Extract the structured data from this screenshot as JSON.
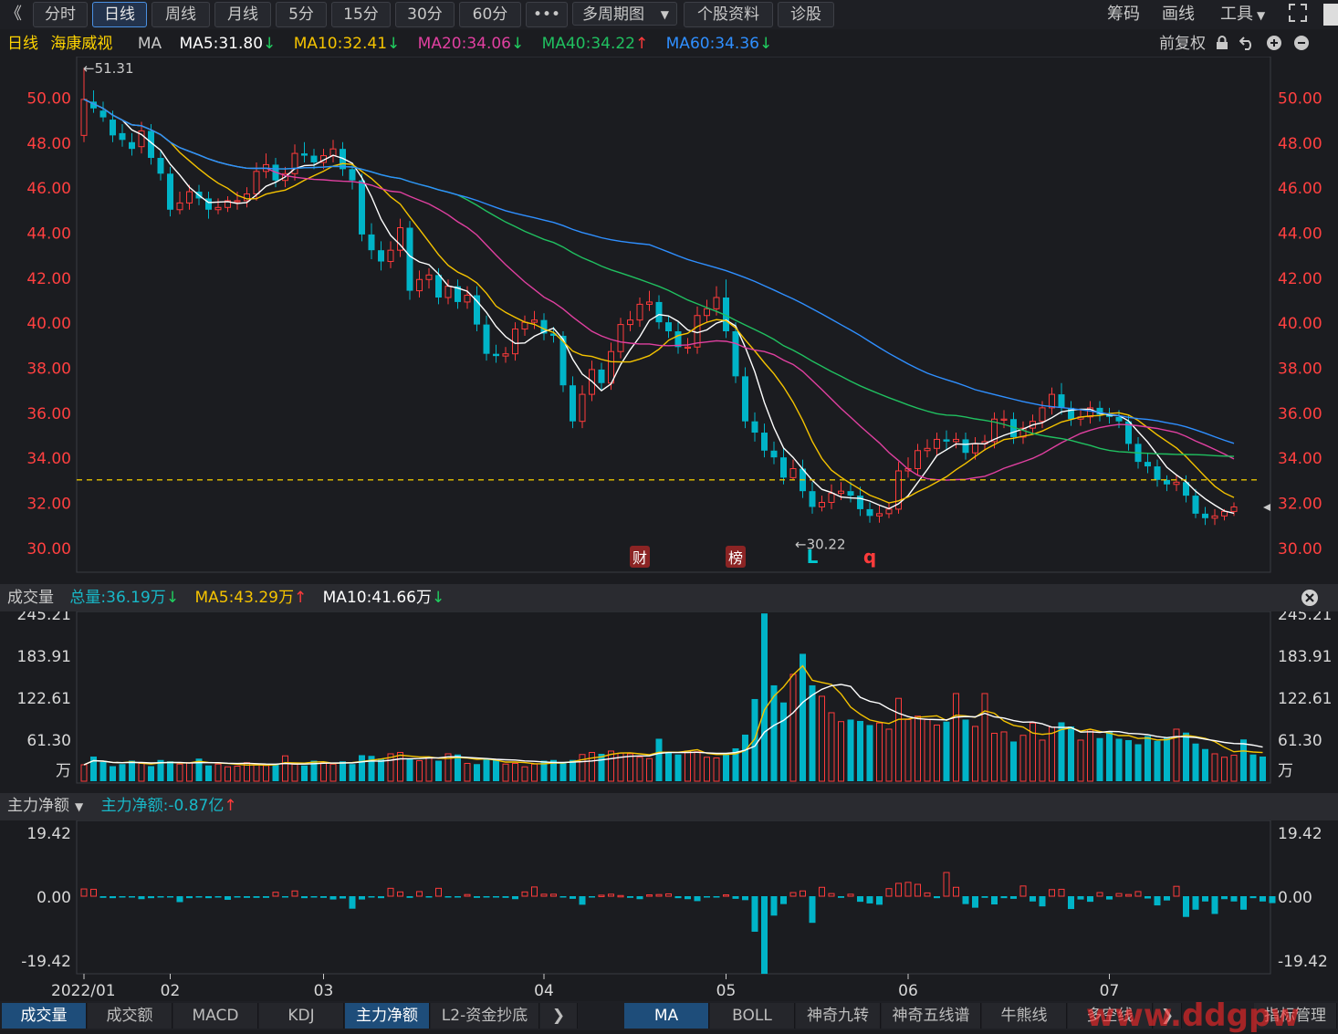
{
  "toolbar": {
    "back_label": "《",
    "periods": [
      "分时",
      "日线",
      "周线",
      "月线",
      "5分",
      "15分",
      "30分",
      "60分"
    ],
    "active_period": "日线",
    "more_label": "•••",
    "multi_period_label": "多周期图",
    "stock_info_label": "个股资料",
    "diagnose_label": "诊股",
    "chips_label": "筹码",
    "draw_label": "画线",
    "tools_label": "工具",
    "fullscreen_icon": "expand-icon"
  },
  "main_legend": {
    "period": "日线",
    "stock_name": "海康威视",
    "indicator": "MA",
    "ma5": "MA5:31.80",
    "ma10": "MA10:32.41",
    "ma20": "MA20:34.06",
    "ma40": "MA40:34.22",
    "ma60": "MA60:34.36",
    "adjust_label": "前复权"
  },
  "volume_legend": {
    "title": "成交量",
    "total": "总量:36.19万",
    "ma5": "MA5:43.29万",
    "ma10": "MA10:41.66万"
  },
  "flow_legend": {
    "title": "主力净额",
    "value": "主力净额:-0.87亿"
  },
  "colors": {
    "up": "#ff3b3b",
    "down": "#00b4c8",
    "ma5": "#ffffff",
    "ma10": "#f5c300",
    "ma20": "#e040a0",
    "ma40": "#20c060",
    "ma60": "#2f8fff",
    "price_axis": "#ff4040",
    "dashed": "#e6c200"
  },
  "chart_data": [
    {
      "type": "candlestick",
      "title": "海康威视 日线",
      "y_ticks": [
        "50.00",
        "48.00",
        "46.00",
        "44.00",
        "42.00",
        "40.00",
        "38.00",
        "36.00",
        "34.00",
        "32.00",
        "30.00"
      ],
      "ylim": [
        29.0,
        51.5
      ],
      "high_marker": "←51.31",
      "low_marker": "←30.22",
      "reference_line": 33.0,
      "event_markers": [
        {
          "label": "财",
          "x_index": 58
        },
        {
          "label": "榜",
          "x_index": 68
        }
      ],
      "signal_markers": [
        {
          "label": "L",
          "x_index": 76,
          "color": "#00c8d0"
        },
        {
          "label": "q",
          "x_index": 82,
          "color": "#ff3b3b"
        }
      ],
      "x_ticks": [
        {
          "label": "2022/01",
          "index": 0
        },
        {
          "label": "02",
          "index": 9
        },
        {
          "label": "03",
          "index": 25
        },
        {
          "label": "04",
          "index": 48
        },
        {
          "label": "05",
          "index": 67
        },
        {
          "label": "06",
          "index": 86
        },
        {
          "label": "07",
          "index": 107
        }
      ],
      "candles": {
        "open": [
          48.3,
          49.8,
          49.4,
          49.0,
          48.4,
          48.0,
          47.8,
          48.5,
          47.3,
          46.6,
          45.0,
          45.3,
          45.8,
          45.5,
          45.0,
          45.1,
          45.4,
          45.4,
          45.7,
          46.7,
          47.0,
          46.3,
          46.6,
          47.5,
          47.4,
          47.1,
          47.4,
          47.7,
          46.8,
          46.3,
          43.9,
          43.2,
          42.7,
          43.2,
          44.2,
          41.4,
          41.9,
          42.1,
          41.1,
          41.6,
          40.9,
          41.2,
          39.9,
          38.6,
          38.5,
          38.6,
          39.7,
          40.0,
          40.1,
          39.5,
          39.4,
          37.2,
          35.6,
          36.8,
          37.9,
          37.3,
          38.7,
          39.9,
          40.1,
          40.8,
          40.9,
          40.0,
          39.6,
          38.9,
          38.9,
          40.3,
          40.6,
          41.1,
          39.6,
          37.6,
          35.6,
          35.1,
          34.3,
          34.0,
          33.1,
          33.5,
          32.5,
          31.8,
          32.0,
          32.4,
          32.5,
          32.3,
          31.7,
          31.4,
          31.5,
          31.7,
          33.4,
          33.5,
          34.3,
          34.4,
          34.8,
          34.7,
          34.8,
          34.2,
          34.6,
          34.7,
          35.7,
          35.7,
          34.9,
          35.3,
          35.6,
          36.2,
          36.8,
          36.2,
          35.7,
          35.8,
          36.2,
          35.9,
          35.8,
          35.6,
          34.6,
          33.8,
          33.6,
          33.0,
          32.8,
          32.9,
          32.3,
          31.5,
          31.3,
          31.4,
          31.6
        ],
        "close": [
          49.9,
          49.5,
          49.1,
          48.3,
          48.1,
          47.7,
          48.5,
          47.3,
          46.6,
          45.0,
          45.3,
          45.8,
          45.5,
          45.0,
          45.1,
          45.4,
          45.4,
          45.7,
          46.7,
          47.0,
          46.3,
          46.6,
          47.5,
          47.4,
          47.1,
          47.4,
          47.7,
          46.8,
          46.3,
          43.9,
          43.2,
          42.7,
          43.2,
          44.2,
          41.4,
          41.9,
          42.1,
          41.1,
          41.6,
          40.9,
          41.2,
          39.9,
          38.6,
          38.5,
          38.6,
          39.7,
          40.0,
          40.1,
          39.5,
          39.4,
          37.2,
          35.6,
          36.8,
          37.9,
          37.3,
          38.7,
          39.9,
          40.1,
          40.8,
          40.9,
          40.0,
          39.6,
          38.9,
          38.9,
          40.3,
          40.6,
          41.1,
          39.6,
          37.6,
          35.6,
          35.1,
          34.3,
          34.0,
          33.1,
          33.5,
          32.5,
          31.8,
          32.0,
          32.4,
          32.5,
          32.3,
          31.7,
          31.4,
          31.5,
          31.7,
          33.4,
          33.5,
          34.3,
          34.4,
          34.8,
          34.7,
          34.8,
          34.2,
          34.6,
          34.7,
          35.7,
          35.7,
          34.9,
          35.3,
          35.6,
          36.2,
          36.8,
          36.2,
          35.7,
          35.8,
          36.2,
          35.9,
          35.8,
          35.6,
          34.6,
          33.8,
          33.6,
          33.0,
          32.8,
          32.9,
          32.3,
          31.5,
          31.3,
          31.4,
          31.6,
          31.8
        ],
        "high": [
          51.3,
          50.3,
          49.8,
          49.4,
          48.8,
          48.4,
          48.9,
          48.8,
          47.6,
          46.9,
          45.8,
          46.1,
          46.1,
          45.8,
          45.5,
          45.6,
          45.8,
          46.0,
          47.1,
          47.5,
          47.3,
          46.9,
          47.9,
          48.0,
          47.7,
          47.7,
          48.1,
          48.0,
          47.1,
          46.6,
          44.4,
          43.6,
          43.6,
          44.6,
          44.5,
          42.3,
          42.4,
          42.4,
          41.9,
          41.9,
          41.6,
          41.6,
          40.3,
          39.0,
          38.9,
          40.0,
          40.3,
          40.5,
          40.4,
          39.8,
          39.6,
          37.6,
          37.2,
          38.3,
          38.2,
          39.1,
          40.2,
          40.5,
          41.1,
          41.4,
          41.2,
          40.3,
          40.0,
          39.3,
          40.7,
          41.0,
          41.6,
          41.9,
          40.0,
          38.0,
          36.0,
          35.5,
          34.7,
          34.4,
          33.9,
          33.9,
          32.9,
          32.3,
          32.8,
          32.9,
          32.9,
          32.7,
          32.0,
          31.9,
          32.0,
          33.8,
          34.0,
          34.6,
          34.8,
          35.1,
          35.2,
          35.1,
          35.1,
          34.9,
          35.0,
          36.0,
          36.1,
          36.0,
          35.6,
          35.9,
          36.5,
          37.1,
          37.3,
          36.5,
          36.1,
          36.5,
          36.5,
          36.2,
          36.1,
          35.9,
          34.9,
          34.2,
          33.9,
          33.2,
          33.2,
          33.2,
          32.6,
          31.8,
          31.7,
          31.7,
          32.0
        ],
        "low": [
          48.0,
          49.3,
          48.9,
          48.0,
          47.8,
          47.4,
          47.5,
          47.0,
          46.3,
          44.7,
          44.8,
          45.0,
          45.2,
          44.6,
          44.8,
          44.9,
          45.0,
          45.1,
          45.4,
          46.4,
          46.0,
          46.0,
          46.3,
          47.1,
          46.8,
          46.8,
          47.1,
          46.5,
          45.9,
          43.6,
          42.8,
          42.3,
          42.4,
          42.9,
          41.0,
          41.1,
          41.5,
          40.8,
          40.8,
          40.6,
          40.6,
          39.6,
          38.3,
          38.2,
          38.2,
          38.3,
          39.4,
          39.7,
          39.2,
          39.1,
          36.9,
          35.3,
          35.3,
          36.5,
          37.0,
          37.0,
          38.4,
          39.6,
          39.8,
          40.5,
          39.7,
          39.3,
          38.6,
          38.6,
          38.6,
          40.0,
          40.3,
          39.3,
          37.3,
          35.3,
          34.7,
          34.0,
          33.7,
          32.8,
          33.0,
          32.2,
          31.5,
          31.6,
          31.7,
          32.1,
          32.0,
          31.4,
          31.1,
          31.1,
          31.3,
          31.5,
          33.1,
          33.2,
          34.0,
          34.1,
          34.3,
          34.4,
          33.9,
          33.9,
          34.3,
          34.4,
          35.3,
          34.6,
          34.6,
          35.0,
          35.3,
          35.9,
          35.9,
          35.4,
          35.4,
          35.5,
          35.6,
          35.5,
          35.3,
          34.3,
          33.5,
          33.3,
          32.7,
          32.5,
          32.5,
          32.0,
          31.3,
          31.0,
          31.0,
          31.2,
          31.4
        ]
      },
      "ma_series": [
        {
          "name": "MA5",
          "color": "#ffffff",
          "end": 31.8
        },
        {
          "name": "MA10",
          "color": "#f5c300",
          "end": 32.41
        },
        {
          "name": "MA20",
          "color": "#e040a0",
          "end": 34.06
        },
        {
          "name": "MA40",
          "color": "#20c060",
          "end": 34.22
        },
        {
          "name": "MA60",
          "color": "#2f8fff",
          "end": 34.36
        }
      ]
    },
    {
      "type": "bar",
      "title": "成交量",
      "unit": "万",
      "y_ticks": [
        "245.21",
        "183.91",
        "122.61",
        "61.30"
      ],
      "ylim": [
        0,
        245.21
      ],
      "values": [
        24,
        36,
        28,
        22,
        25,
        30,
        26,
        22,
        31,
        29,
        25,
        27,
        33,
        23,
        25,
        21,
        22,
        27,
        24,
        23,
        24,
        37,
        25,
        23,
        30,
        27,
        25,
        29,
        25,
        38,
        37,
        33,
        40,
        42,
        32,
        30,
        34,
        30,
        40,
        39,
        26,
        25,
        33,
        31,
        25,
        26,
        21,
        25,
        30,
        31,
        26,
        31,
        39,
        42,
        40,
        44,
        41,
        40,
        35,
        33,
        62,
        42,
        39,
        44,
        43,
        35,
        34,
        39,
        48,
        68,
        120,
        245,
        140,
        115,
        156,
        186,
        140,
        124,
        100,
        87,
        90,
        88,
        82,
        85,
        76,
        121,
        90,
        95,
        90,
        82,
        87,
        128,
        90,
        80,
        128,
        70,
        72,
        58,
        67,
        85,
        60,
        79,
        86,
        80,
        60,
        75,
        63,
        73,
        62,
        60,
        54,
        66,
        59,
        64,
        76,
        71,
        55,
        47,
        40,
        35,
        38,
        61,
        39,
        36
      ],
      "ma_series": [
        {
          "name": "MA5",
          "color": "#f5c300",
          "end": 43.29
        },
        {
          "name": "MA10",
          "color": "#ffffff",
          "end": 41.66
        }
      ],
      "last_total": 36.19
    },
    {
      "type": "bar",
      "title": "主力净额",
      "unit": "亿",
      "y_ticks": [
        "19.42",
        "0.00",
        "-19.42"
      ],
      "ylim": [
        -19.42,
        19.42
      ],
      "values": [
        2.2,
        2.1,
        -0.5,
        -0.6,
        -0.4,
        -0.3,
        -0.9,
        -0.6,
        -0.4,
        -0.4,
        -1.8,
        -0.6,
        -0.3,
        -0.6,
        -0.4,
        -1.1,
        -0.3,
        -0.5,
        -0.5,
        -0.5,
        1.2,
        -0.2,
        1.6,
        -0.6,
        -0.4,
        -0.5,
        -1.0,
        -0.7,
        -3.8,
        -1.0,
        -0.4,
        -0.6,
        2.4,
        1.3,
        -0.5,
        1.4,
        -0.4,
        2.4,
        -0.4,
        -0.2,
        0.5,
        -0.5,
        -0.3,
        -0.4,
        -0.5,
        -0.9,
        1.3,
        2.8,
        0.6,
        0.6,
        -0.3,
        -0.8,
        -2.6,
        -0.4,
        0.3,
        0.6,
        0.2,
        -0.5,
        -0.9,
        0.4,
        0.5,
        0.7,
        -0.6,
        -0.9,
        -1.5,
        -0.3,
        -0.4,
        0.4,
        -0.8,
        -1.2,
        -10.8,
        -23.6,
        -5.9,
        -2.4,
        1.1,
        1.6,
        -8.1,
        2.7,
        0.8,
        -0.5,
        0.6,
        -1.7,
        -2.2,
        -2.6,
        2.3,
        3.9,
        4.2,
        3.6,
        1.0,
        -0.6,
        7.2,
        2.7,
        -2.4,
        -3.5,
        -0.5,
        -2.5,
        -0.6,
        -0.8,
        3.1,
        -1.6,
        -3.1,
        2.0,
        2.1,
        -3.9,
        -1.0,
        -1.7,
        1.1,
        -1.0,
        0.8,
        0.5,
        1.4,
        -0.7,
        -2.8,
        -1.3,
        3.0,
        -6.3,
        -4.1,
        -1.6,
        -5.4,
        -0.9,
        -1.6,
        -4.1,
        -0.6,
        -1.6,
        -2.1
      ]
    }
  ],
  "bottom_tabs_left": [
    "成交量",
    "成交额",
    "MACD",
    "KDJ",
    "主力净额",
    "L2-资金抄底"
  ],
  "bottom_tabs_left_active": [
    "成交量",
    "主力净额"
  ],
  "bottom_tabs_right": [
    "MA",
    "BOLL",
    "神奇九转",
    "神奇五线谱",
    "牛熊线",
    "多空线"
  ],
  "bottom_tab_right_active": "MA",
  "indicator_manage_label": "指标管理",
  "watermark": "www.ddgpw"
}
